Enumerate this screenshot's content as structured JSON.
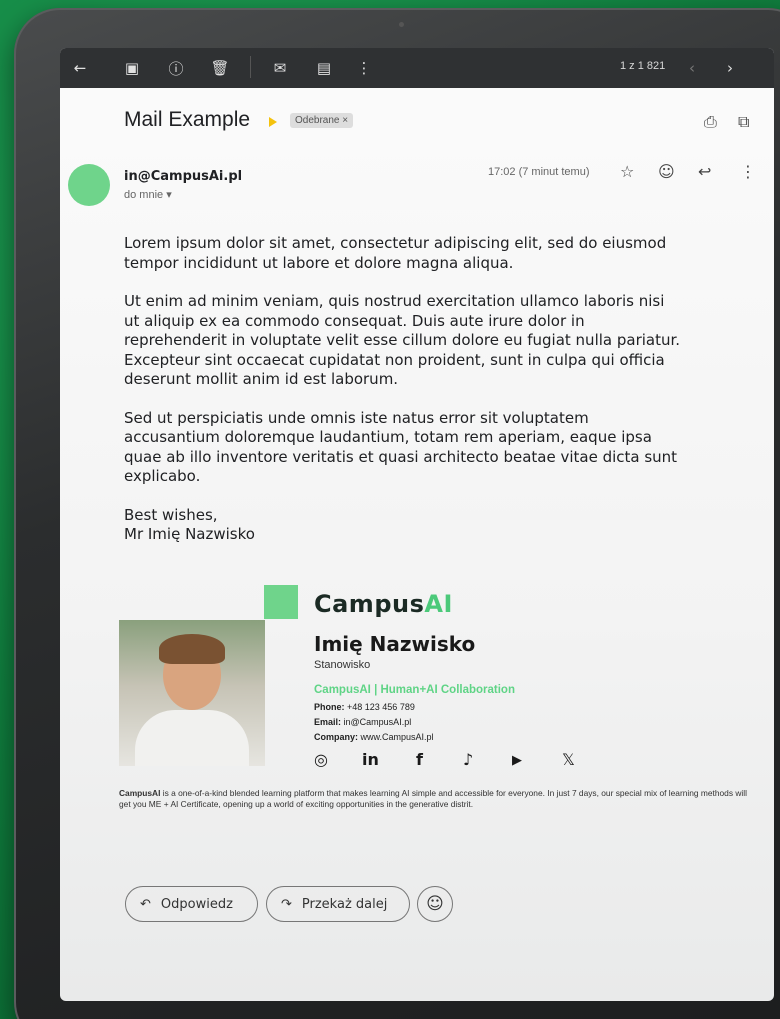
{
  "toolbar": {
    "back_icon": "arrow-left-icon",
    "archive_icon": "archive-icon",
    "spam_icon": "report-spam-icon",
    "delete_icon": "trash-icon",
    "unread_icon": "mark-unread-icon",
    "move_icon": "move-to-folder-icon",
    "more_icon": "more-vertical-icon",
    "count": "1 z 1 821",
    "prev_icon": "chevron-left-icon",
    "next_icon": "chevron-right-icon"
  },
  "email": {
    "subject": "Mail Example",
    "label": "Odebrane ×",
    "sender": "in@CampusAi.pl",
    "to": "do mnie ▾",
    "time": "17:02 (7 minut temu)",
    "paragraphs": [
      "Lorem ipsum dolor sit amet, consectetur adipiscing elit, sed do eiusmod tempor incididunt ut labore et dolore magna aliqua.",
      "Ut enim ad minim veniam, quis nostrud exercitation ullamco laboris nisi ut aliquip ex ea commodo consequat. Duis aute irure dolor in reprehenderit in voluptate velit esse cillum dolore eu fugiat nulla pariatur. Excepteur sint occaecat cupidatat non proident, sunt in culpa qui officia deserunt mollit anim id est laborum.",
      "Sed ut perspiciatis unde omnis iste natus error sit voluptatem accusantium doloremque laudantium, totam rem aperiam, eaque ipsa quae ab illo inventore veritatis et quasi architecto beatae vitae dicta sunt explicabo."
    ],
    "closing": "Best wishes,",
    "closing_name": "Mr Imię Nazwisko"
  },
  "signature": {
    "logo_main": "Campus",
    "logo_accent": "AI",
    "name": "Imię Nazwisko",
    "role": "Stanowisko",
    "tagline": "CampusAI | Human+AI Collaboration",
    "phone_label": "Phone:",
    "phone": "+48 123 456 789",
    "email_label": "Email:",
    "email": "in@CampusAI.pl",
    "company_label": "Company:",
    "company": "www.CampusAI.pl",
    "social": {
      "instagram": "◎",
      "linkedin": "in",
      "facebook": "f",
      "tiktok": "♪",
      "youtube": "▶",
      "x": "𝕏"
    },
    "footer_brand": "CampusAI",
    "footer_text": " is a one-of-a-kind blended learning platform that makes learning AI simple and accessible for everyone. In just 7 days, our special mix of learning methods will get you ME + AI Certificate, opening up a world of exciting opportunities in the generative distrit."
  },
  "actions": {
    "reply": "Odpowiedz",
    "forward": "Przekaż dalej"
  },
  "colors": {
    "brand_green": "#6fd48b",
    "toolbar_bg": "#2f3133",
    "label_arrow": "#f4c20d"
  }
}
